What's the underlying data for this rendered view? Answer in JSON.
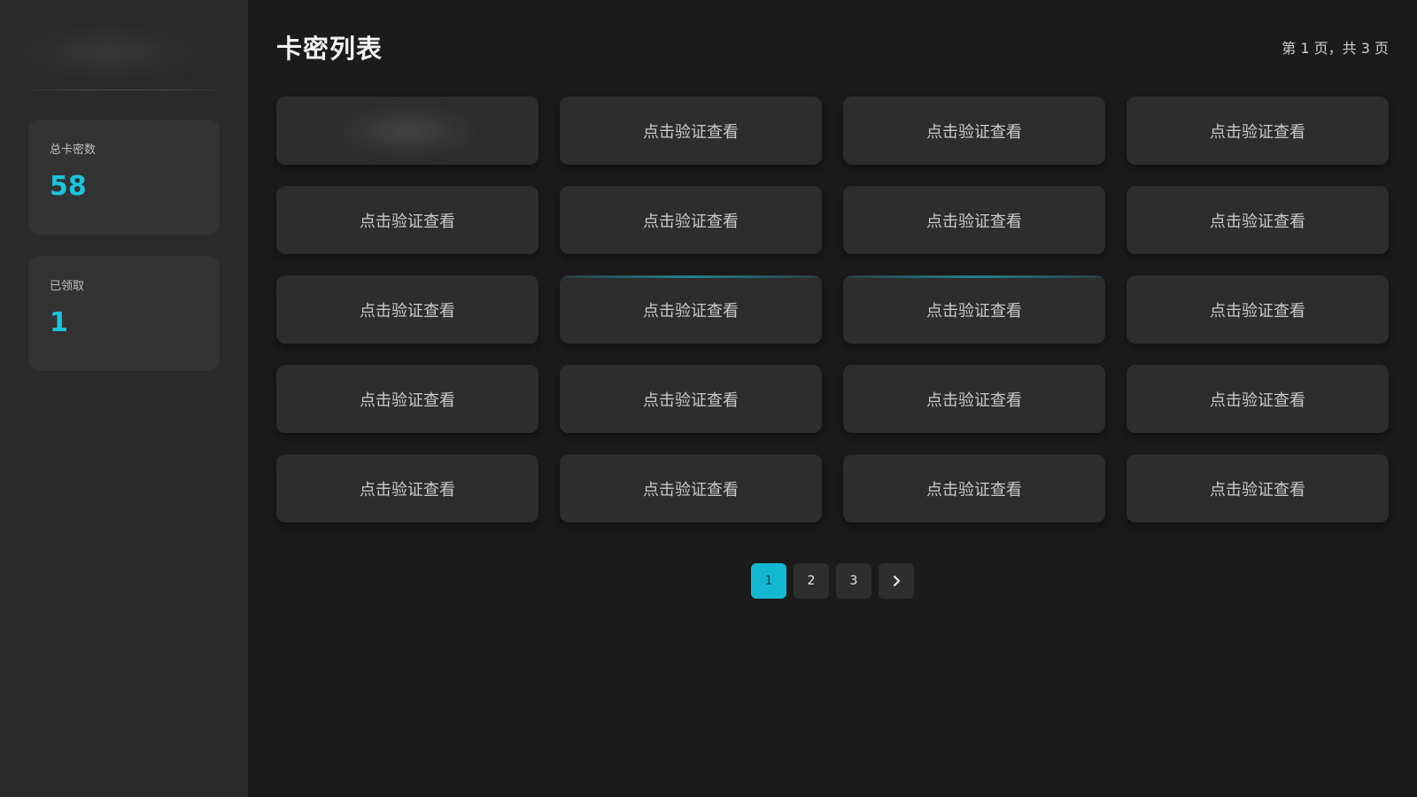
{
  "sidebar": {
    "stats": [
      {
        "label": "总卡密数",
        "value": "58"
      },
      {
        "label": "已领取",
        "value": "1"
      }
    ]
  },
  "main": {
    "title": "卡密列表",
    "page_info": "第 1 页，共 3 页",
    "cards": [
      {
        "label": ""
      },
      {
        "label": "点击验证查看"
      },
      {
        "label": "点击验证查看"
      },
      {
        "label": "点击验证查看"
      },
      {
        "label": "点击验证查看"
      },
      {
        "label": "点击验证查看"
      },
      {
        "label": "点击验证查看"
      },
      {
        "label": "点击验证查看"
      },
      {
        "label": "点击验证查看"
      },
      {
        "label": "点击验证查看"
      },
      {
        "label": "点击验证查看"
      },
      {
        "label": "点击验证查看"
      },
      {
        "label": "点击验证查看"
      },
      {
        "label": "点击验证查看"
      },
      {
        "label": "点击验证查看"
      },
      {
        "label": "点击验证查看"
      },
      {
        "label": "点击验证查看"
      },
      {
        "label": "点击验证查看"
      },
      {
        "label": "点击验证查看"
      },
      {
        "label": "点击验证查看"
      }
    ],
    "pagination": {
      "pages": [
        "1",
        "2",
        "3"
      ],
      "current": "1",
      "next_icon": "chevron-right-icon"
    }
  },
  "colors": {
    "accent": "#1cc4dd",
    "active_page": "#12b8d2",
    "sidebar_bg": "#2a2a2a",
    "main_bg": "#1b1b1b",
    "card_bg": "#2d2d2d"
  }
}
